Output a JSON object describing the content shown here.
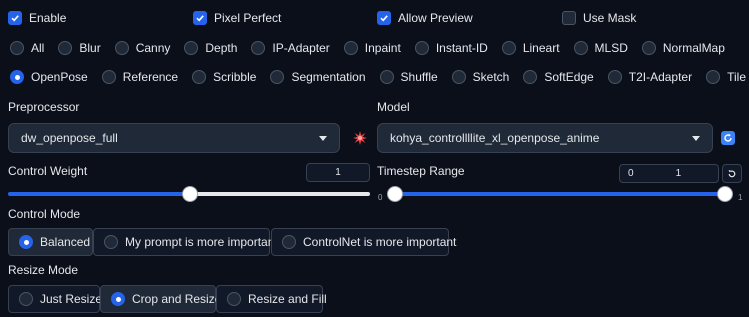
{
  "checkboxes": [
    {
      "label": "Enable",
      "checked": true
    },
    {
      "label": "Pixel Perfect",
      "checked": true
    },
    {
      "label": "Allow Preview",
      "checked": true
    },
    {
      "label": "Use Mask",
      "checked": false
    }
  ],
  "control_types_row1": [
    "All",
    "Blur",
    "Canny",
    "Depth",
    "IP-Adapter",
    "Inpaint",
    "Instant-ID",
    "Lineart",
    "MLSD",
    "NormalMap"
  ],
  "control_types_row2": [
    "OpenPose",
    "Reference",
    "Scribble",
    "Segmentation",
    "Shuffle",
    "Sketch",
    "SoftEdge",
    "T2I-Adapter",
    "Tile"
  ],
  "control_type_selected": "OpenPose",
  "preprocessor": {
    "label": "Preprocessor",
    "value": "dw_openpose_full"
  },
  "model": {
    "label": "Model",
    "value": "kohya_controllllite_xl_openpose_anime"
  },
  "control_weight": {
    "label": "Control Weight",
    "value": "1",
    "fraction": 0.5
  },
  "timestep_range": {
    "label": "Timestep Range",
    "start": "0",
    "end": "1",
    "min_tick": "0",
    "max_tick": "1"
  },
  "control_mode": {
    "label": "Control Mode",
    "options": [
      "Balanced",
      "My prompt is more important",
      "ControlNet is more important"
    ],
    "selected": "Balanced"
  },
  "resize_mode": {
    "label": "Resize Mode",
    "options": [
      "Just Resize",
      "Crop and Resize",
      "Resize and Fill"
    ],
    "selected": "Crop and Resize"
  },
  "colors": {
    "accent": "#2563eb",
    "background": "#0b0f19",
    "explosion_icon": "#ef4444",
    "refresh_icon": "#3b82f6"
  }
}
